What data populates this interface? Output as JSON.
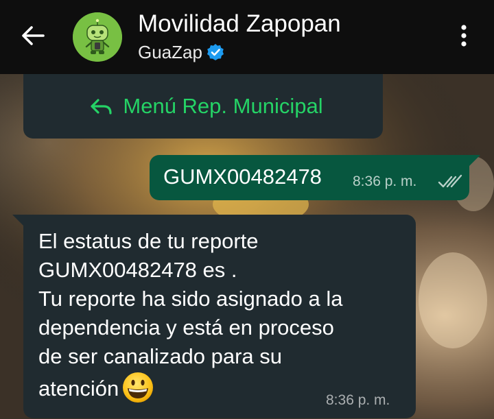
{
  "header": {
    "title": "Movilidad Zapopan",
    "subtitle": "GuaZap",
    "icons": {
      "back": "arrow-back-icon",
      "verified": "verified-badge-icon",
      "menu": "more-vert-icon"
    },
    "colors": {
      "background": "#0e0e0e",
      "verified": "#1d9bf0",
      "avatar": "#78c043"
    }
  },
  "messages": {
    "menu_button": {
      "label": "Menú Rep. Municipal",
      "icon": "reply-arrow-icon",
      "color": "#25d366"
    },
    "outgoing": {
      "text": "GUMX00482478",
      "time": "8:36 p. m.",
      "status_icon": "double-check-icon",
      "color": "#07573f"
    },
    "incoming": {
      "lines": [
        "El estatus de tu reporte",
        "GUMX00482478 es .",
        "Tu reporte ha sido asignado a la",
        "dependencia y está en proceso",
        "de ser canalizado para su",
        "atención"
      ],
      "emoji": "grinning-face-emoji",
      "time": "8:36 p. m.",
      "color": "#202b30"
    }
  }
}
